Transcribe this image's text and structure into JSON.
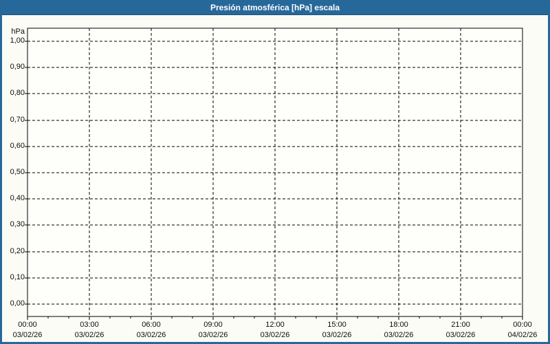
{
  "window": {
    "title": "Presión atmosférica [hPa] escala"
  },
  "colors": {
    "titlebar_bg": "#27689B",
    "titlebar_edge": "#1C5076",
    "titlebar_text": "#FFFFFF",
    "border": "#27689B",
    "window_bg": "#FCFCF6",
    "plot_bg": "#FEFEFB",
    "axis_line": "#000000",
    "grid_line": "#000000",
    "tick_text": "#0B0B0F"
  },
  "y_axis": {
    "unit_label": "hPa",
    "tick_labels": [
      "1,00",
      "0,90",
      "0,80",
      "0,70",
      "0,60",
      "0,50",
      "0,40",
      "0,30",
      "0,20",
      "0,10",
      "0,00"
    ]
  },
  "x_axis": {
    "ticks": [
      {
        "time": "00:00",
        "date": "03/02/26"
      },
      {
        "time": "03:00",
        "date": "03/02/26"
      },
      {
        "time": "06:00",
        "date": "03/02/26"
      },
      {
        "time": "09:00",
        "date": "03/02/26"
      },
      {
        "time": "12:00",
        "date": "03/02/26"
      },
      {
        "time": "15:00",
        "date": "03/02/26"
      },
      {
        "time": "18:00",
        "date": "03/02/26"
      },
      {
        "time": "21:00",
        "date": "03/02/26"
      },
      {
        "time": "00:00",
        "date": "04/02/26"
      }
    ],
    "minor_ticks_per_major": 3
  },
  "chart_data": {
    "type": "line",
    "title": "Presión atmosférica [hPa] escala",
    "xlabel": "",
    "ylabel": "hPa",
    "ylim": [
      0.0,
      1.0
    ],
    "y_tick_step": 0.1,
    "y_tick_labels": [
      "1,00",
      "0,90",
      "0,80",
      "0,70",
      "0,60",
      "0,50",
      "0,40",
      "0,30",
      "0,20",
      "0,10",
      "0,00"
    ],
    "x_tick_labels": [
      "00:00 03/02/26",
      "03:00 03/02/26",
      "06:00 03/02/26",
      "09:00 03/02/26",
      "12:00 03/02/26",
      "15:00 03/02/26",
      "18:00 03/02/26",
      "21:00 03/02/26",
      "00:00 04/02/26"
    ],
    "x_minor_tick_interval_hours": 1,
    "grid": true,
    "grid_style": "dashed",
    "legend": "none",
    "series": []
  }
}
